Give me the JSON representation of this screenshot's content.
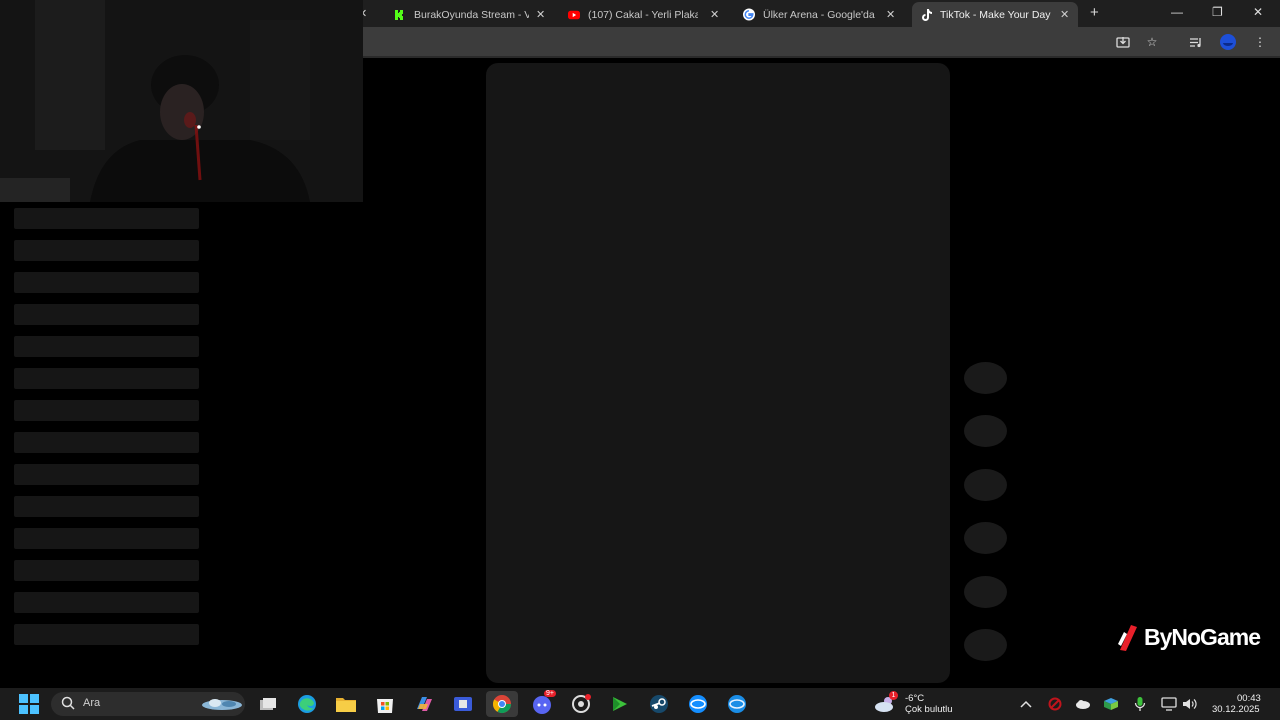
{
  "browser": {
    "tabs": [
      {
        "title": "BurakOyunda Stream - V",
        "icon": "kick-icon",
        "active": false
      },
      {
        "title": "(107) Cakal - Yerli Plaka",
        "icon": "youtube-icon",
        "active": false
      },
      {
        "title": "Ülker Arena - Google'da",
        "icon": "google-icon",
        "active": false
      },
      {
        "title": "TikTok - Make Your Day",
        "icon": "tiktok-icon",
        "active": true
      }
    ],
    "new_tab_label": "+",
    "window_controls": {
      "minimize": "—",
      "restore": "❐",
      "close": "✕"
    }
  },
  "page": {
    "skeleton_row_count": 14,
    "action_button_count": 6
  },
  "overlay": {
    "logo_text": "ByNoGame",
    "brand_color": "#e8202a"
  },
  "taskbar": {
    "search_placeholder": "Ara",
    "weather_temp": "-6°C",
    "weather_desc": "Çok bulutlu",
    "weather_badge": "1",
    "clock_time": "00:43",
    "clock_date": "30.12.2025",
    "discord_badge": "9+",
    "apps": [
      "start-icon",
      "search-icon",
      "task-view-icon",
      "edge-icon",
      "file-explorer-icon",
      "store-icon",
      "copilot-icon",
      "app-icon",
      "chrome-icon",
      "discord-icon",
      "steelseries-icon",
      "game-launcher-icon",
      "steam-icon",
      "battlenet-icon",
      "battlenet-icon-2"
    ]
  }
}
